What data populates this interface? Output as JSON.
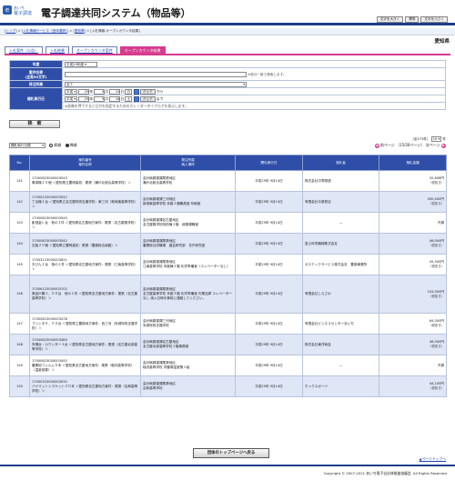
{
  "header": {
    "logo_mark": "e",
    "logo_top": "あいち",
    "logo_bottom": "電子調達",
    "title": "電子調達共同システム（物品等）",
    "font_buttons": [
      "文字を大きく",
      "標準",
      "文字を小さく"
    ]
  },
  "breadcrumb": {
    "items": [
      "トップ",
      "入札情報サービス（団体選択）",
      "愛知県"
    ],
    "current": "入札情報-オープンカウンタ結果"
  },
  "org_name": "愛知県",
  "tabs": [
    {
      "label": "入札案件（公告）",
      "active": false
    },
    {
      "label": "入札結果",
      "active": false
    },
    {
      "label": "オープンカウンタ案件",
      "active": false
    },
    {
      "label": "オープンカウンタ結果",
      "active": true
    }
  ],
  "form": {
    "year_label": "年度",
    "year_value": "平成29年度",
    "name_label": "案件名称",
    "name_sub": "(全角50文字)",
    "name_note": "※部分一致で検索します。",
    "org_label": "発注所属",
    "org_value": "全て",
    "date_label": "開札執行日",
    "era": "平成",
    "from": {
      "year": "29",
      "month": "9",
      "day": "10",
      "dow": "日"
    },
    "to": {
      "year": "29",
      "month": "9",
      "day": "16",
      "dow": "土"
    },
    "clear_label": "クリア",
    "from_suffix": "から",
    "to_suffix": "まで",
    "y_suffix": "年",
    "m_suffix": "月",
    "d_suffix": "日",
    "cal_note": "※画像を押下すると日付を指定するためのカレンダーダイアログを表示します。",
    "search_label": "検　索"
  },
  "toolbar": {
    "sort_value": "開札執行日順",
    "asc_label": "昇順",
    "desc_label": "降順",
    "count_text": "（全273件）",
    "per_page": "10",
    "per_page_suffix": "件",
    "prev_label": "前ページ",
    "page_info": "（15/28ページ）",
    "next_label": "次ページ"
  },
  "table": {
    "headers": [
      "No.",
      "案件番号\n案件名称",
      "発注所属\n納入場所",
      "開札執行日",
      "落札者",
      "落札金額"
    ],
    "rows": [
      {
        "no": "141",
        "id": "17000623000003543",
        "name": "電卓機１０個 ＜愛知県立豊明高校：尾張（瀬戸北総合高等学校）＞",
        "org": "会計局調達課尾張地区",
        "place": "瀬戸北総合高等学校",
        "date": "平成29年 9月14日",
        "winner": "株式会社中寿物語",
        "amount": "20,808円",
        "tax": "（税抜き）"
      },
      {
        "no": "142",
        "id": "17000223000003542",
        "name": "丁合機１台 ＜愛知県立名古屋特別支援学校：東三河（新城東高等学校）＞",
        "org": "会計局調達課三河地区",
        "place": "新城東高等学校 本館１階職員室 印刷室",
        "date": "平成29年 9月14日",
        "winner": "有限会社今泉鉄店",
        "amount": "350,400円",
        "tax": "（税抜き）"
      },
      {
        "no": "143",
        "id": "17000623000003545",
        "name": "影縫金1 台　他の１件 ＜愛知県名古屋地方案件：尾張（名古屋聾学校）＞",
        "org": "会計局調達課名古屋地区",
        "place": "名古屋聾学校特別棟１階　総務課職室",
        "date": "平成29年 9月14日",
        "winner": "—",
        "amount": "不調",
        "tax": ""
      },
      {
        "no": "144",
        "id": "17000623000003542",
        "name": "石板２０個 ＜愛知県立豊明高校：尾張（豊橋総合製館）＞",
        "org": "会計局調達課尾張地区",
        "place": "農業総合試験場　園芸研究部　花卉研究室",
        "date": "平成29年 9月14日",
        "winner": "富士科学器械株式会社",
        "amount": "46,000円",
        "tax": "（税抜き）"
      },
      {
        "no": "145",
        "id": "17003123000003621",
        "name": "天びん１台　他の１件 ＜愛知県名古屋地方案件：尾張（江南高等学校）＞",
        "org": "会計局調達課尾張地区",
        "place": "江南高等学校 本館棟１階 化学準備室（エレベーターなし）",
        "date": "平成29年 9月14日",
        "winner": "ガステックサービス株式会社　豊橋事業所",
        "amount": "45,500円",
        "tax": "（税抜き）"
      },
      {
        "no": "146",
        "id": "17006123000003702",
        "name": "美品戸棚１，００台　他の１件 ＜愛知県名古屋地方案件：尾張（名古屋高等学校）＞",
        "org": "会計局調達課尾張地区",
        "place": "名古屋高等学校 本館３階 化学準備室 内業品庫 エレベーターなし 納入日時を事前に連絡してください。",
        "date": "平成29年 9月14日",
        "winner": "有限会社しらさわ",
        "amount": "104,500円",
        "tax": "（税抜き）"
      },
      {
        "no": "147",
        "id": "17000623000003478",
        "name": "プリンタ５，００台 ＜愛知県立豊橋地方案件：西三河（安城特別支援学校）＞",
        "org": "会計局調達課三河地区",
        "place": "安城特別支援学校",
        "date": "平成29年 9月14日",
        "winner": "有限会社ビジネスセンターあいち",
        "amount": "64,000円",
        "tax": "（税抜き）"
      },
      {
        "no": "148",
        "id": "17000623000003484",
        "name": "売場台・カウンター１台 ＜愛知県名古屋地方案件：尾張（名古屋北部高等学校）＞",
        "org": "会計局調達課名古屋地区",
        "place": "名古屋北部高等学校１階事務室",
        "date": "平成29年 9月14日",
        "winner": "株式会社東洋商会",
        "amount": "46,000円",
        "tax": "（税抜き）"
      },
      {
        "no": "149",
        "id": "17000623000003492",
        "name": "農業用フィルム５本 ＜愛知県名古屋地方案件：尾張（稲沢高等学校）（温室部委）＞",
        "org": "会計局調達課尾張地区",
        "place": "稲沢高等学校 学農場温室第１組",
        "date": "平成29年 9月14日",
        "winner": "—",
        "amount": "不調",
        "tax": ""
      },
      {
        "no": "150",
        "id": "17000323000003932",
        "name": "バドミントンラケット３０本 ＜愛知県名古屋地方案件：尾張（吉和高等学校）＞",
        "org": "会計局調達課尾張地区",
        "place": "吉和高等学校",
        "date": "平成29年 9月14日",
        "winner": "ホックスポーツ",
        "amount": "44,100円",
        "tax": "（税抜き）"
      }
    ]
  },
  "home_button": "団体のトップページへ戻る",
  "page_top": "▲ページトップへ",
  "copyright": "Copyright © 2007-2021 あいち電子自治体推進協議会. All Rights Reserved."
}
